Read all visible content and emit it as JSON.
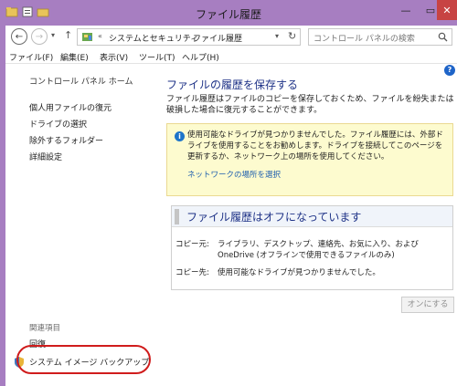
{
  "window": {
    "title": "ファイル履歴",
    "minimize_glyph": "—",
    "maximize_glyph": "▭",
    "close_glyph": "✕"
  },
  "address": {
    "back_glyph": "←",
    "forward_glyph": "→",
    "history_glyph": "▾",
    "up_glyph": "↑",
    "sep": "«",
    "crumb_sep": "›",
    "crumb1": "システムとセキュリティ",
    "crumb2": "ファイル履歴",
    "dropdown_glyph": "▾",
    "refresh_glyph": "↻",
    "search_placeholder": "コントロール パネルの検索"
  },
  "menu": {
    "file": "ファイル(F)",
    "edit": "編集(E)",
    "view": "表示(V)",
    "tools": "ツール(T)",
    "help": "ヘルプ(H)",
    "help_icon": "?"
  },
  "sidebar": {
    "home": "コントロール パネル ホーム",
    "items": [
      {
        "label": "個人用ファイルの復元"
      },
      {
        "label": "ドライブの選択"
      },
      {
        "label": "除外するフォルダー"
      },
      {
        "label": "詳細設定"
      }
    ],
    "related_title": "関連項目",
    "recovery": "回復",
    "system_image_backup": "システム イメージ バックアップ"
  },
  "main": {
    "title": "ファイルの履歴を保存する",
    "description": "ファイル履歴はファイルのコピーを保存しておくため、ファイルを紛失または破損した場合に復元することができます。",
    "warning": {
      "icon": "i",
      "text": "使用可能なドライブが見つかりませんでした。ファイル履歴には、外部ドライブを使用することをお勧めします。ドライブを接続してこのページを更新するか、ネットワーク上の場所を使用してください。",
      "link": "ネットワークの場所を選択"
    },
    "status": {
      "title": "ファイル履歴はオフになっています",
      "copy_from_label": "コピー元:",
      "copy_from_value": "ライブラリ、デスクトップ、連絡先、お気に入り、および OneDrive (オフラインで使用できるファイルのみ)",
      "copy_to_label": "コピー先:",
      "copy_to_value": "使用可能なドライブが見つかりませんでした。"
    },
    "turn_on_button": "オンにする"
  },
  "colors": {
    "window_frame": "#a77ec1",
    "close_button": "#c74343",
    "heading_blue": "#1e3287",
    "link_blue": "#1f5fae",
    "warning_bg": "#fdfbcf",
    "annotation_red": "#d01c1c"
  }
}
